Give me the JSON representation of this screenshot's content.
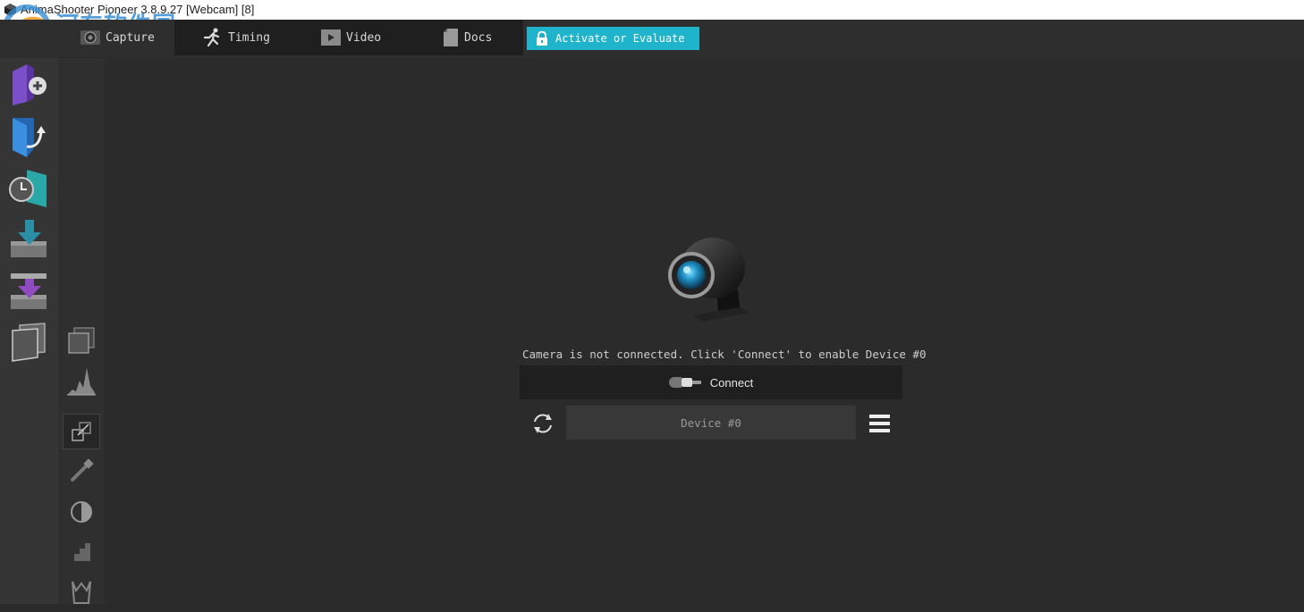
{
  "window": {
    "title": "AnimaShooter Pioneer 3.8.9.27 [Webcam] [8]"
  },
  "watermark": {
    "text": "河东软件园",
    "url": "www.pc0359.cn"
  },
  "tabs": [
    {
      "label": "Capture",
      "icon": "aperture-icon"
    },
    {
      "label": "Timing",
      "icon": "running-man-icon"
    },
    {
      "label": "Video",
      "icon": "play-icon"
    },
    {
      "label": "Docs",
      "icon": "document-icon"
    }
  ],
  "activate": {
    "label": "Activate or Evaluate",
    "icon": "lock-icon",
    "color": "#1fb4cc"
  },
  "left_toolbar": [
    {
      "icon": "new-project-icon"
    },
    {
      "icon": "open-project-icon"
    },
    {
      "icon": "recent-project-icon"
    },
    {
      "icon": "import-icon"
    },
    {
      "icon": "export-icon"
    },
    {
      "icon": "frames-icon"
    }
  ],
  "mid_toolbar": [
    {
      "icon": "onion-skin-icon"
    },
    {
      "icon": "histogram-icon"
    },
    {
      "icon": "resize-icon"
    },
    {
      "icon": "eyedropper-icon"
    },
    {
      "icon": "contrast-icon"
    },
    {
      "icon": "steps-icon"
    },
    {
      "icon": "chroma-key-icon"
    }
  ],
  "camera": {
    "status_message": "Camera is not connected. Click 'Connect' to enable Device #0",
    "connect_label": "Connect",
    "device_label": "Device #0"
  }
}
